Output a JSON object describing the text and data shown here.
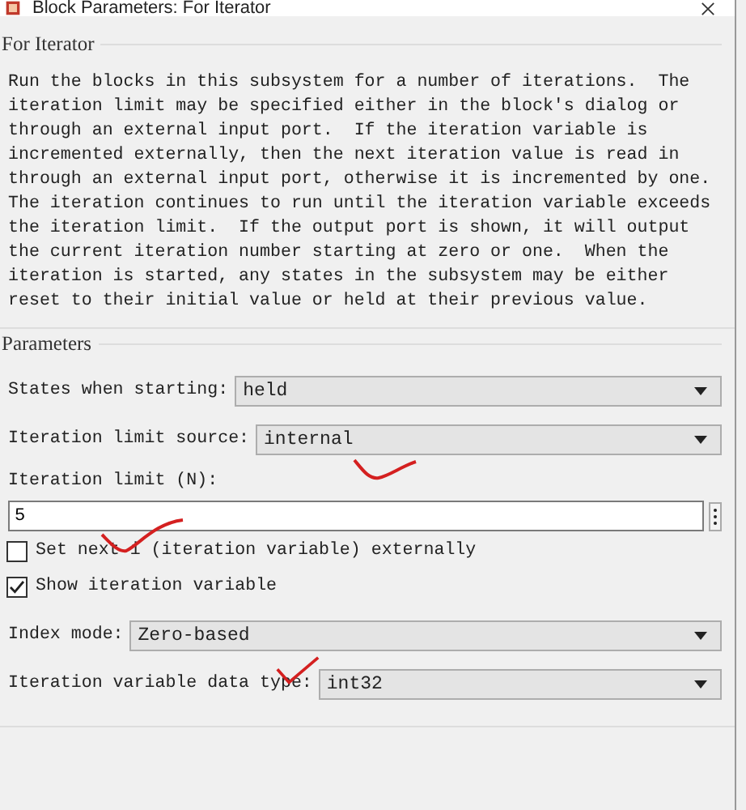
{
  "window": {
    "title": "Block Parameters: For Iterator"
  },
  "description": {
    "heading": "For Iterator",
    "text": "Run the blocks in this subsystem for a number of iterations.  The iteration limit may be specified either in the block's dialog or through an external input port.  If the iteration variable is incremented externally, then the next iteration value is read in through an external input port, otherwise it is incremented by one. The iteration continues to run until the iteration variable exceeds the iteration limit.  If the output port is shown, it will output the current iteration number starting at zero or one.  When the iteration is started, any states in the subsystem may be either reset to their initial value or held at their previous value."
  },
  "parameters": {
    "heading": "Parameters",
    "items": [
      {
        "kind": "dropdown",
        "label": "States when starting:",
        "value": "held"
      },
      {
        "kind": "dropdown",
        "label": "Iteration limit source:",
        "value": "internal"
      },
      {
        "kind": "textfield",
        "label": "Iteration limit (N):",
        "value": "5"
      },
      {
        "kind": "checkbox",
        "label": "Set next i (iteration variable) externally",
        "checked": false
      },
      {
        "kind": "checkbox",
        "label": "Show iteration variable",
        "checked": true
      },
      {
        "kind": "dropdown",
        "label": "Index mode:",
        "value": "Zero-based"
      },
      {
        "kind": "dropdown",
        "label": "Iteration variable data type:",
        "value": "int32"
      }
    ]
  }
}
